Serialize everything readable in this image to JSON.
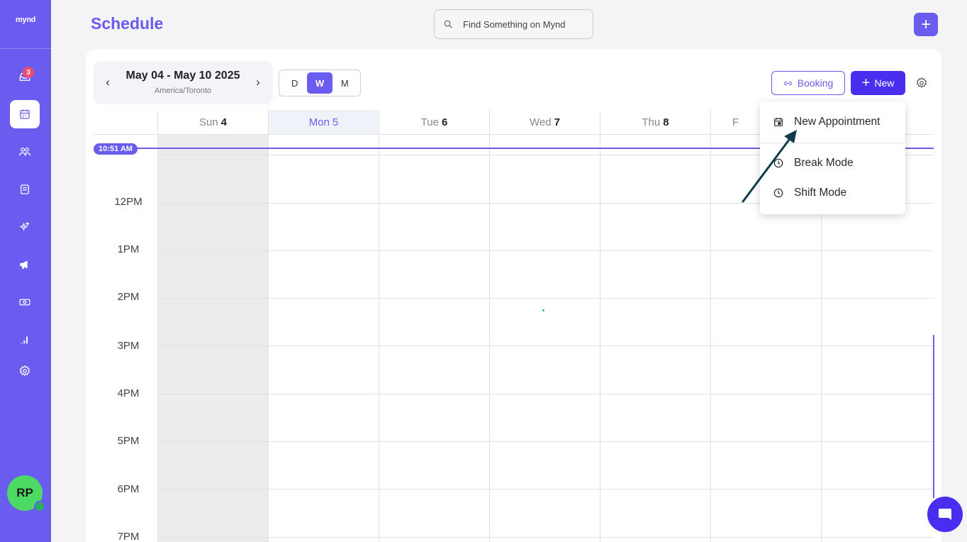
{
  "app": {
    "logo": "mynd",
    "page_title": "Schedule"
  },
  "search": {
    "placeholder": "Find Something on Mynd"
  },
  "sidebar": {
    "inbox_badge": "3",
    "items": [
      "inbox",
      "schedule",
      "clients",
      "services",
      "ai",
      "marketing",
      "payments",
      "reports",
      "settings"
    ],
    "user_initials": "RP"
  },
  "toolbar": {
    "date_range": "May 04 - May 10 2025",
    "timezone": "America/Toronto",
    "views": [
      "D",
      "W",
      "M"
    ],
    "active_view": "W",
    "booking_label": "Booking",
    "new_label": "New"
  },
  "calendar": {
    "days": [
      {
        "name": "Sun",
        "num": "4"
      },
      {
        "name": "Mon",
        "num": "5"
      },
      {
        "name": "Tue",
        "num": "6"
      },
      {
        "name": "Wed",
        "num": "7"
      },
      {
        "name": "Thu",
        "num": "8"
      },
      {
        "name": "F",
        "num": ""
      },
      {
        "name": "",
        "num": ""
      }
    ],
    "times": [
      "12PM",
      "1PM",
      "2PM",
      "3PM",
      "4PM",
      "5PM",
      "6PM",
      "7PM"
    ],
    "current_time": "10:51 AM"
  },
  "dropdown": {
    "new_appointment": "New Appointment",
    "break_mode": "Break Mode",
    "shift_mode": "Shift Mode"
  },
  "colors": {
    "accent": "#6b5cf0",
    "primary_button": "#4a2ef0",
    "avatar": "#4cd964",
    "badge": "#ef4b6c"
  }
}
